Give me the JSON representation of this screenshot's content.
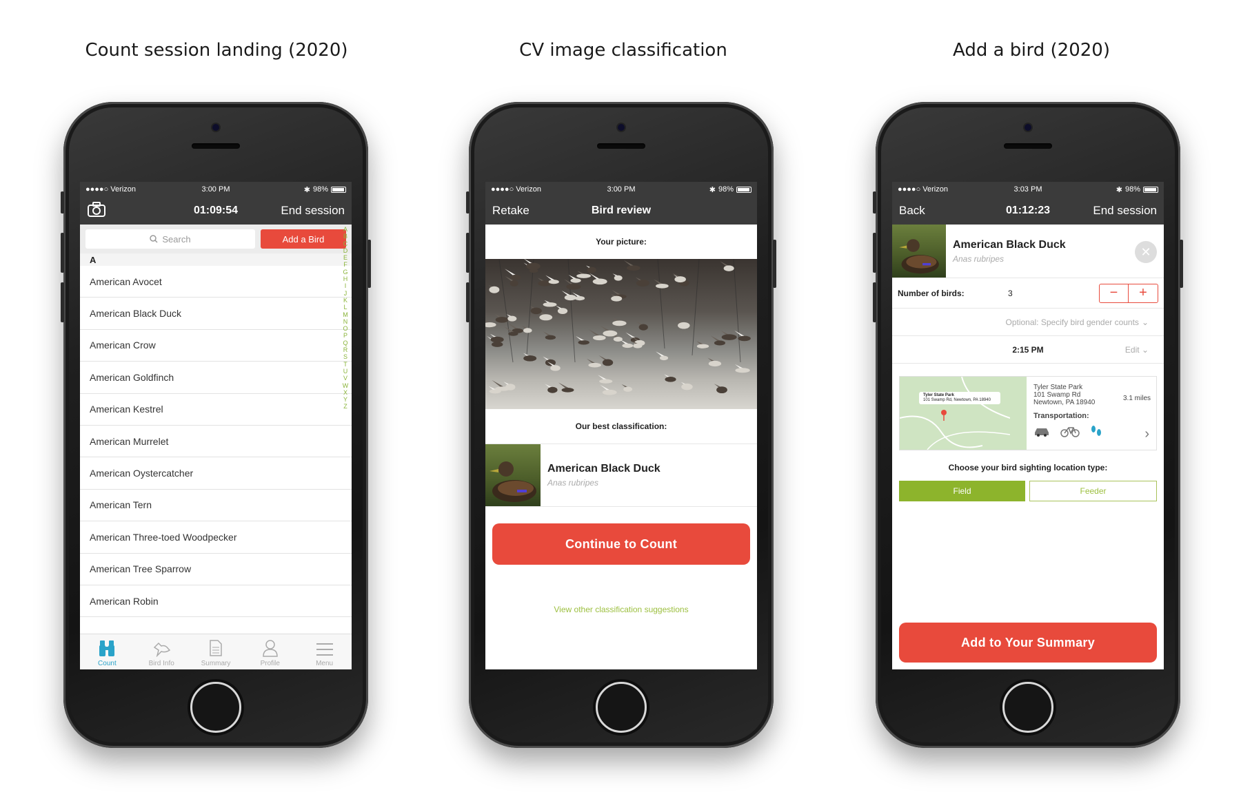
{
  "captions": [
    "Count session landing (2020)",
    "CV image classification",
    "Add a bird (2020)"
  ],
  "status": {
    "carrier": "●●●●○ Verizon",
    "battery": "98%",
    "times": [
      "3:00 PM",
      "3:00 PM",
      "3:03 PM"
    ]
  },
  "screen1": {
    "timer": "01:09:54",
    "end_label": "End session",
    "search_placeholder": "Search",
    "add_label": "Add a Bird",
    "section": "A",
    "birds": [
      "American Avocet",
      "American Black Duck",
      "American Crow",
      "American Goldfinch",
      "American Kestrel",
      "American Murrelet",
      "American Oystercatcher",
      "American Tern",
      "American Three-toed Woodpecker",
      "American Tree Sparrow",
      "American Robin"
    ],
    "alphabet": [
      "A",
      "B",
      "C",
      "D",
      "E",
      "F",
      "G",
      "H",
      "I",
      "J",
      "K",
      "L",
      "M",
      "N",
      "O",
      "P",
      "Q",
      "R",
      "S",
      "T",
      "U",
      "V",
      "W",
      "X",
      "Y",
      "Z"
    ],
    "tabs": [
      "Count",
      "Bird Info",
      "Summary",
      "Profile",
      "Menu"
    ]
  },
  "screen2": {
    "back_label": "Retake",
    "title": "Bird review",
    "picture_label": "Your picture:",
    "classification_label": "Our best classification:",
    "bird_name": "American Black Duck",
    "bird_sci": "Anas rubripes",
    "continue_label": "Continue to Count",
    "link_label": "View other classification suggestions"
  },
  "screen3": {
    "back_label": "Back",
    "timer": "01:12:23",
    "end_label": "End session",
    "bird_name": "American Black Duck",
    "bird_sci": "Anas rubripes",
    "count_label": "Number of birds:",
    "count_value": "3",
    "gender_label": "Optional:  Specify bird gender counts",
    "time_value": "2:15 PM",
    "edit_label": "Edit",
    "map_pin_title": "Tyler State Park",
    "map_pin_address": "101 Swamp Rd, Newtown, PA 18940",
    "loc_name": "Tyler State Park",
    "loc_street": "101 Swamp Rd",
    "loc_city": "Newtown, PA 18940",
    "distance": "3.1 miles",
    "transport_label": "Transportation:",
    "location_type_label": "Choose your bird sighting location type:",
    "field_label": "Field",
    "feeder_label": "Feeder",
    "add_summary_label": "Add to Your Summary"
  },
  "colors": {
    "accent_red": "#e84a3c",
    "nav_dark": "#3b3b3b",
    "green": "#8db42c",
    "teal": "#2aa3c9"
  }
}
